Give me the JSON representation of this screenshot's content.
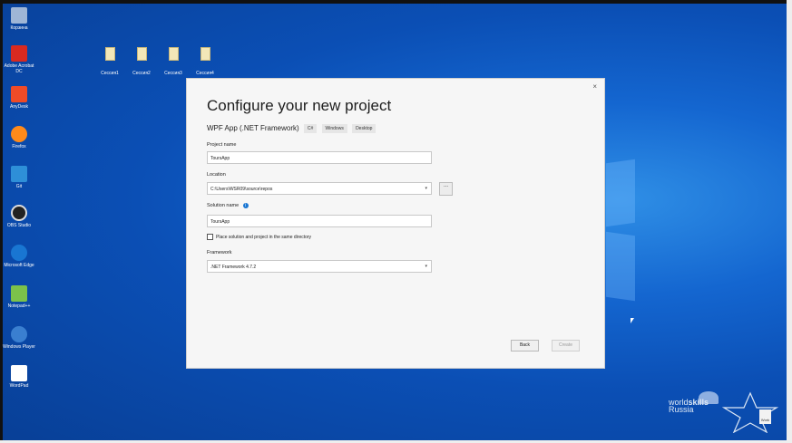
{
  "desktop_icons": [
    {
      "label": "Корзина",
      "color": "#9fb6d6"
    },
    {
      "label": "Adobe Acrobat DC",
      "color": "#d82a20"
    },
    {
      "label": "AnyDesk",
      "color": "#ef4b27"
    },
    {
      "label": "Firefox",
      "color": "#ff8a1a"
    },
    {
      "label": "Git",
      "color": "#2e8fd8"
    },
    {
      "label": "OBS Studio",
      "color": "#222222"
    },
    {
      "label": "Microsoft Edge",
      "color": "#1976d2"
    },
    {
      "label": "Notepad++",
      "color": "#7cc24a"
    },
    {
      "label": "Windows Player",
      "color": "#3a7fd0"
    },
    {
      "label": "WordPad",
      "color": "#ffffff"
    }
  ],
  "file_icons": [
    {
      "label": "Сессия1"
    },
    {
      "label": "Сессия2"
    },
    {
      "label": "Сессия3"
    },
    {
      "label": "Сессия4"
    }
  ],
  "dialog": {
    "close_label": "×",
    "title": "Configure your new project",
    "template_name": "WPF App (.NET Framework)",
    "tags": [
      "C#",
      "Windows",
      "Desktop"
    ],
    "project_name_label": "Project name",
    "project_name_value": "ToursApp",
    "location_label": "Location",
    "location_value": "C:\\Users\\WSR09\\source\\repos",
    "browse_label": "...",
    "solution_name_label": "Solution name",
    "info_icon": "i",
    "solution_name_value": "ToursApp",
    "same_dir_label": "Place solution and project in the same directory",
    "framework_label": "Framework",
    "framework_value": ".NET Framework 4.7.2",
    "back_label": "Back",
    "create_label": "Create"
  },
  "branding": {
    "worldskills_line1": "world",
    "worldskills_line1b": "skills",
    "worldskills_line2": "Russia",
    "work_label": "Work"
  }
}
